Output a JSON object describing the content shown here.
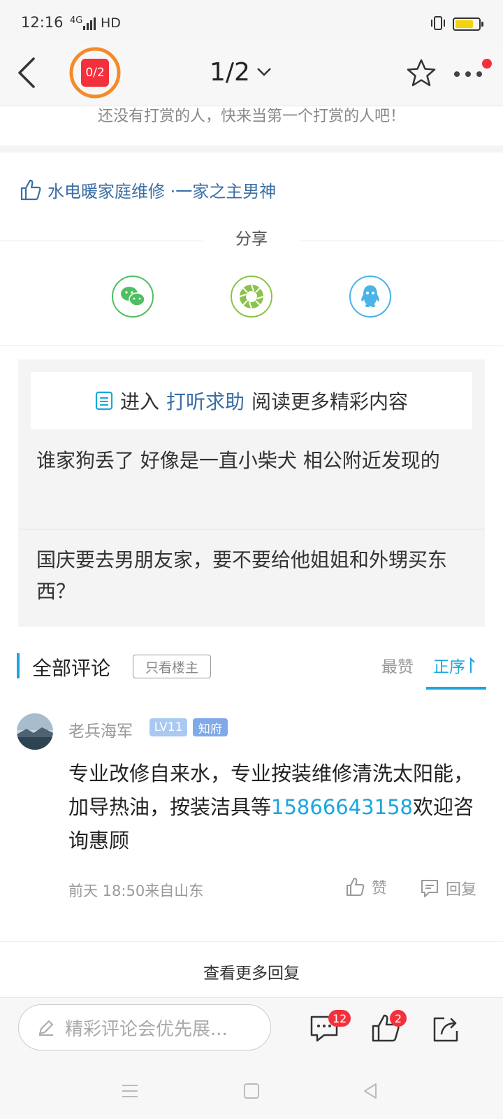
{
  "status_bar": {
    "time": "12:16",
    "network": "4G",
    "hd": "HD"
  },
  "header": {
    "progress_label": "0/2",
    "page_indicator": "1/2"
  },
  "reward": {
    "text": "还没有打赏的人，快来当第一个打赏的人吧！"
  },
  "author_likes": {
    "text": "水电暖家庭维修 ·一家之主男神"
  },
  "share": {
    "title": "分享",
    "icons": [
      "wechat-icon",
      "moments-icon",
      "qq-icon"
    ]
  },
  "related": {
    "enter_prefix": "进入",
    "enter_highlight": "打听求助",
    "enter_suffix": "阅读更多精彩内容",
    "items": [
      "谁家狗丢了 好像是一直小柴犬 相公附近发现的",
      "国庆要去男朋友家，要不要给他姐姐和外甥买东西？"
    ]
  },
  "comments": {
    "title": "全部评论",
    "only_owner": "只看楼主",
    "sort_top": "最赞",
    "sort_order": "正序",
    "item": {
      "user": "老兵海军",
      "level": "LV11",
      "title_badge": "知府",
      "text_before": "专业改修自来水，专业按装维修清洗太阳能，加导热油，按装洁具等",
      "phone": "15866643158",
      "text_after": "欢迎咨询惠顾",
      "meta": "前天 18:50来自山东",
      "like_label": "赞",
      "reply_label": "回复"
    },
    "more_replies": "查看更多回复"
  },
  "bottom_bar": {
    "input_placeholder": "精彩评论会优先展...",
    "comment_count": "12",
    "like_count": "2"
  },
  "colors": {
    "accent": "#1ba6e0",
    "link": "#3a6ea5",
    "badge_red": "#f3303c",
    "progress_orange": "#f58a2a"
  }
}
